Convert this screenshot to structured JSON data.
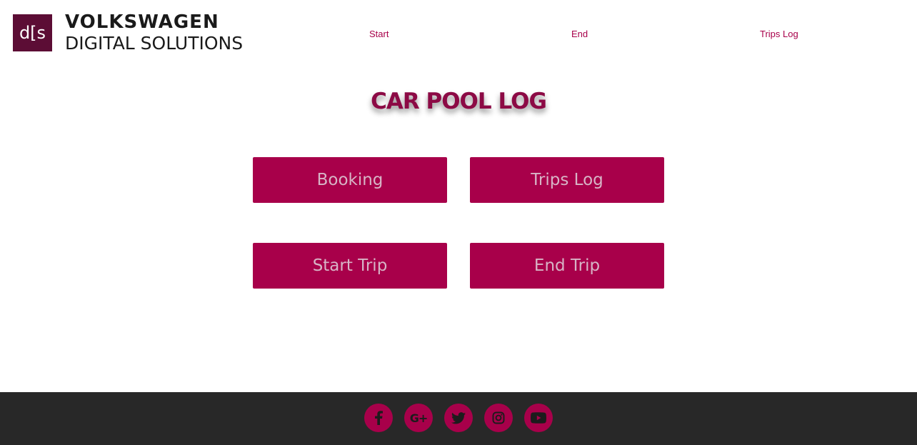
{
  "header": {
    "logo_mark": "d[s",
    "logo_line1": "VOLKSWAGEN",
    "logo_line2": "DIGITAL SOLUTIONS",
    "nav": {
      "start": "Start",
      "end": "End",
      "trips_log": "Trips Log"
    }
  },
  "main": {
    "title": "CAR POOL LOG",
    "buttons": {
      "booking": "Booking",
      "trips_log": "Trips Log",
      "start_trip": "Start Trip",
      "end_trip": "End Trip"
    }
  },
  "footer": {
    "social_icons": [
      "facebook-icon",
      "google-plus-icon",
      "twitter-icon",
      "instagram-icon",
      "youtube-icon"
    ],
    "google_plus_glyph": "G+"
  },
  "colors": {
    "brand": "#a8004a",
    "logo_bg": "#5c0d35",
    "button_text": "#d7b4c6",
    "footer_bg": "#282828",
    "icon_color": "#1c1c1c"
  }
}
